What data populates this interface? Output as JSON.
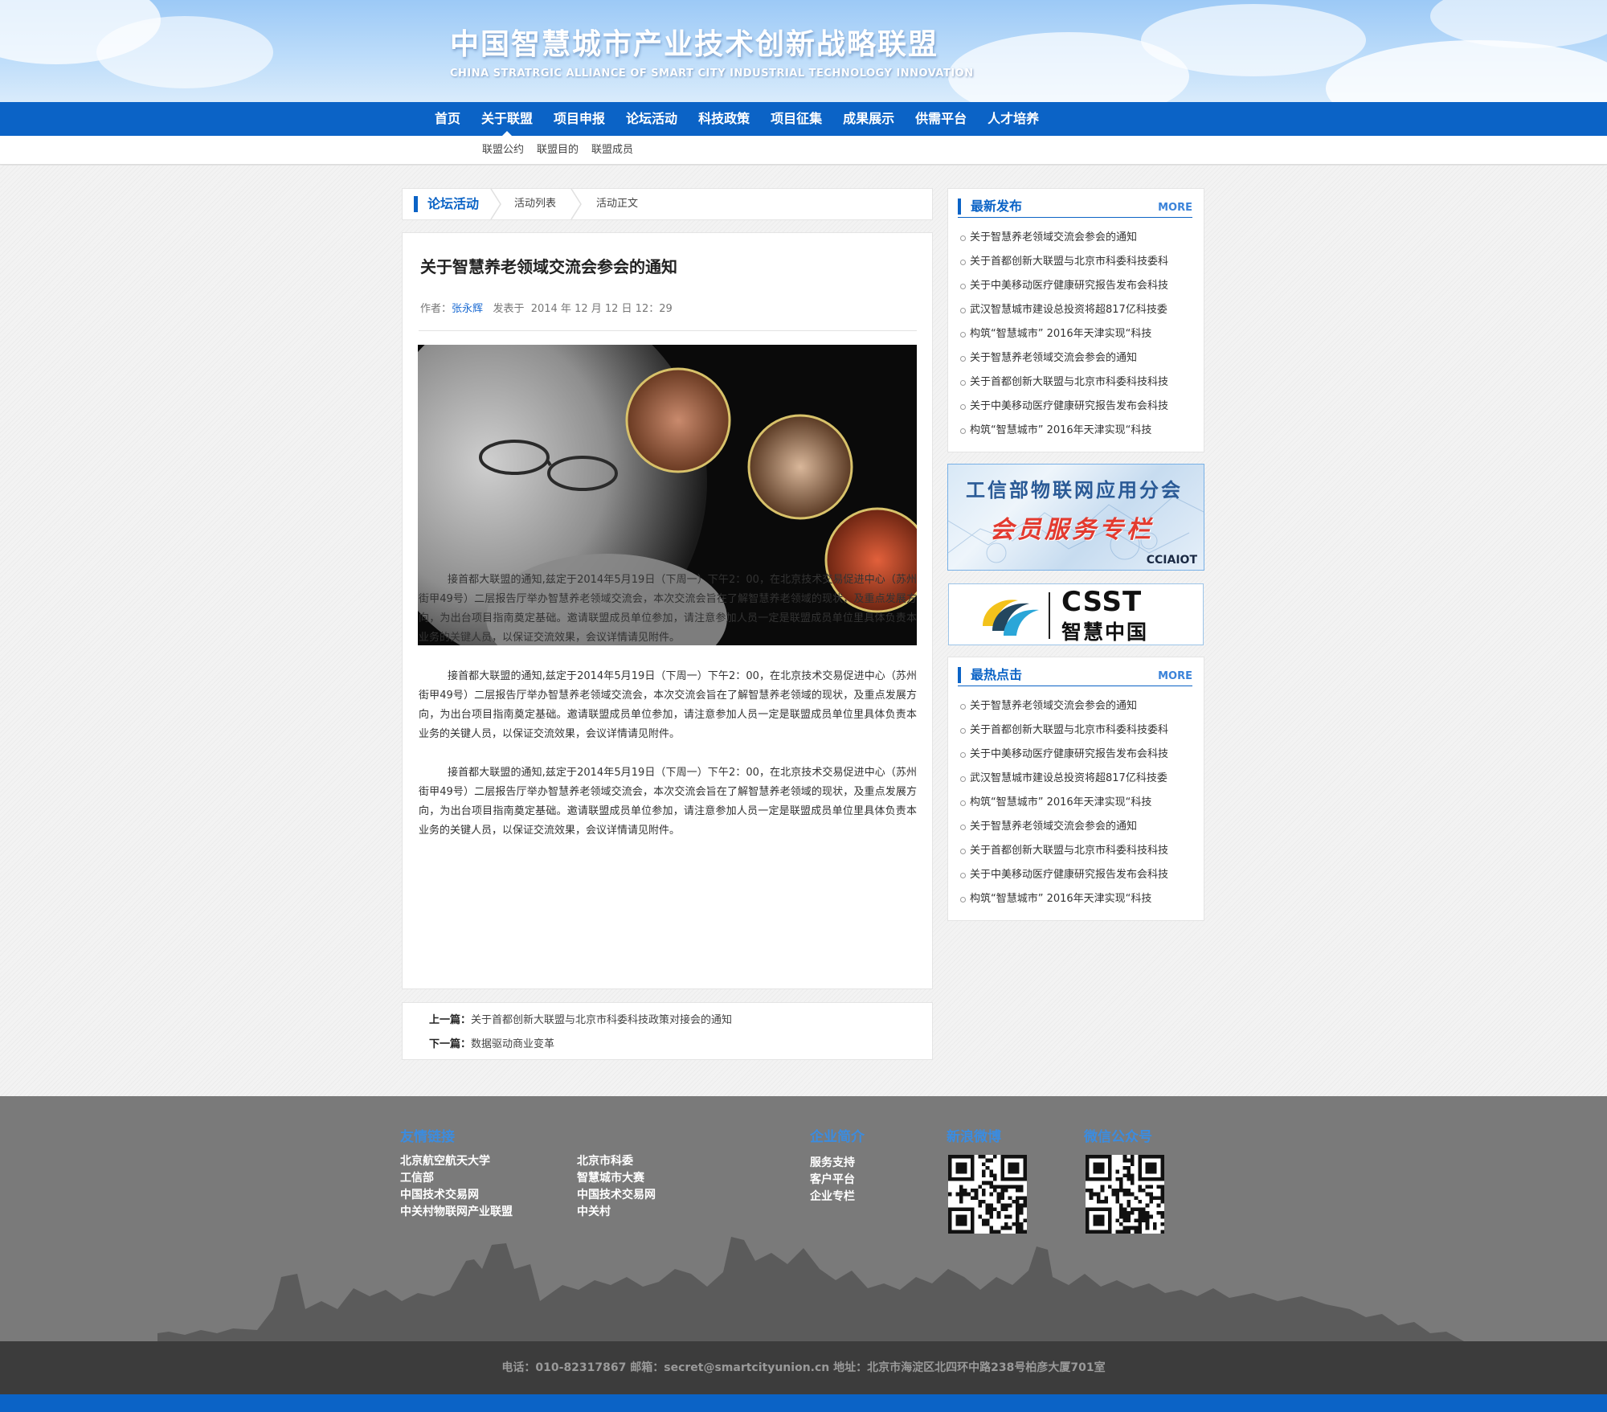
{
  "header": {
    "title": "中国智慧城市产业技术创新战略联盟",
    "subtitle": "CHINA STRATRGIC ALLIANCE OF SMART CITY INDUSTRIAL TECHNOLOGY INNOVATION"
  },
  "nav": {
    "items": [
      "首页",
      "关于联盟",
      "项目申报",
      "论坛活动",
      "科技政策",
      "项目征集",
      "成果展示",
      "供需平台",
      "人才培养"
    ],
    "active": "关于联盟"
  },
  "subnav": {
    "items": [
      "联盟公约",
      "联盟目的",
      "联盟成员"
    ]
  },
  "breadcrumb": {
    "items": [
      "论坛活动",
      "活动列表",
      "活动正文"
    ]
  },
  "article": {
    "title": "关于智慧养老领域交流会参会的通知",
    "author_label": "作者：",
    "author": "张永辉",
    "published_label": "发表于",
    "published": "2014 年 12 月 12 日   12：29",
    "paragraphs": [
      "接首都大联盟的通知,兹定于2014年5月19日（下周一）下午2：00，在北京技术交易促进中心（苏州街甲49号）二层报告厅举办智慧养老领域交流会，本次交流会旨在了解智慧养老领域的现状，及重点发展方向，为出台项目指南奠定基础。邀请联盟成员单位参加，请注意参加人员一定是联盟成员单位里具体负责本业务的关键人员，以保证交流效果，会议详情请见附件。",
      "接首都大联盟的通知,兹定于2014年5月19日（下周一）下午2：00，在北京技术交易促进中心（苏州街甲49号）二层报告厅举办智慧养老领域交流会，本次交流会旨在了解智慧养老领域的现状，及重点发展方向，为出台项目指南奠定基础。邀请联盟成员单位参加，请注意参加人员一定是联盟成员单位里具体负责本业务的关键人员，以保证交流效果，会议详情请见附件。",
      "接首都大联盟的通知,兹定于2014年5月19日（下周一）下午2：00，在北京技术交易促进中心（苏州街甲49号）二层报告厅举办智慧养老领域交流会，本次交流会旨在了解智慧养老领域的现状，及重点发展方向，为出台项目指南奠定基础。邀请联盟成员单位参加，请注意参加人员一定是联盟成员单位里具体负责本业务的关键人员，以保证交流效果，会议详情请见附件。"
    ]
  },
  "prev_next": {
    "prev_label": "上一篇：",
    "prev_title": "关于首都创新大联盟与北京市科委科技政策对接会的通知",
    "next_label": "下一篇：",
    "next_title": "数据驱动商业变革"
  },
  "sidebar": {
    "latest": {
      "title": "最新发布",
      "more": "MORE",
      "items": [
        "关于智慧养老领域交流会参会的通知",
        "关于首都创新大联盟与北京市科委科技委科",
        "关于中美移动医疗健康研究报告发布会科技",
        "武汉智慧城市建设总投资将超817亿科技委",
        "构筑“智慧城市” 2016年天津实现“科技",
        "关于智慧养老领域交流会参会的通知",
        "关于首都创新大联盟与北京市科委科技科技",
        "关于中美移动医疗健康研究报告发布会科技",
        "构筑“智慧城市” 2016年天津实现“科技"
      ]
    },
    "banner1": {
      "line1": "工信部物联网应用分会",
      "line2": "会员服务专栏",
      "tag": "CCIAIOT"
    },
    "banner2": {
      "brand": "CSST",
      "slogan": "智慧中国"
    },
    "hot": {
      "title": "最热点击",
      "more": "MORE",
      "items": [
        "关于智慧养老领域交流会参会的通知",
        "关于首都创新大联盟与北京市科委科技委科",
        "关于中美移动医疗健康研究报告发布会科技",
        "武汉智慧城市建设总投资将超817亿科技委",
        "构筑“智慧城市” 2016年天津实现“科技",
        "关于智慧养老领域交流会参会的通知",
        "关于首都创新大联盟与北京市科委科技科技",
        "关于中美移动医疗健康研究报告发布会科技",
        "构筑“智慧城市” 2016年天津实现“科技"
      ]
    }
  },
  "footer": {
    "links_title": "友情链接",
    "links_col1": [
      "北京航空航天大学",
      "工信部",
      "中国技术交易网",
      "中关村物联网产业联盟"
    ],
    "links_col2": [
      "北京市科委",
      "智慧城市大赛",
      "中国技术交易网",
      "中关村"
    ],
    "company_title": "企业简介",
    "company_links": [
      "服务支持",
      "客户平台",
      "企业专栏"
    ],
    "weibo_title": "新浪微博",
    "wechat_title": "微信公众号",
    "contact": "电话：010-82317867  邮箱：secret@smartcityunion.cn  地址：北京市海淀区北四环中路238号柏彦大厦701室"
  },
  "colors": {
    "brand_blue": "#0b63c6",
    "footer_gray": "#7a7a7a",
    "footer_dark": "#3c3c3c"
  }
}
